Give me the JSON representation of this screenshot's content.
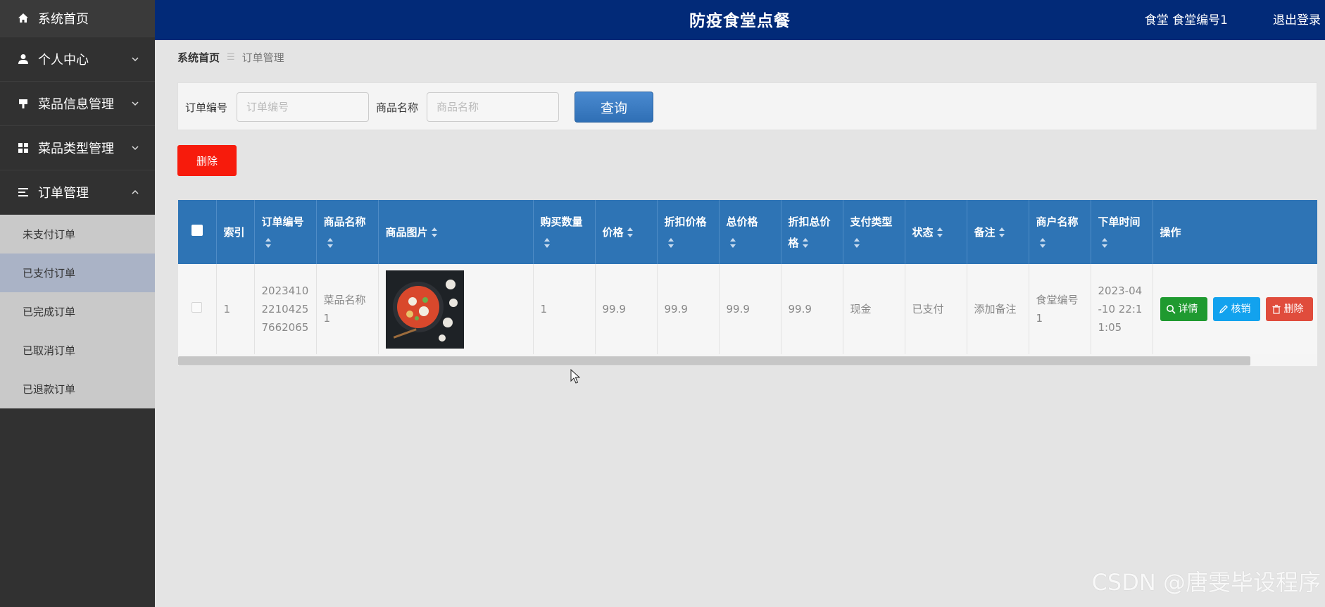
{
  "app": {
    "title": "防疫食堂点餐",
    "user_label": "食堂 食堂编号1",
    "logout_label": "退出登录"
  },
  "sidebar": {
    "items": [
      {
        "label": "系统首页",
        "icon": "home-icon"
      },
      {
        "label": "个人中心",
        "icon": "user-icon"
      },
      {
        "label": "菜品信息管理",
        "icon": "dish-icon"
      },
      {
        "label": "菜品类型管理",
        "icon": "grid-icon"
      },
      {
        "label": "订单管理",
        "icon": "list-icon"
      }
    ],
    "submenu": [
      {
        "label": "未支付订单"
      },
      {
        "label": "已支付订单",
        "active": true
      },
      {
        "label": "已完成订单"
      },
      {
        "label": "已取消订单"
      },
      {
        "label": "已退款订单"
      }
    ]
  },
  "breadcrumb": {
    "home": "系统首页",
    "separator": "☰",
    "current": "订单管理"
  },
  "search": {
    "order_no_label": "订单编号",
    "order_no_placeholder": "订单编号",
    "goods_name_label": "商品名称",
    "goods_name_placeholder": "商品名称",
    "query_label": "查询"
  },
  "actions": {
    "delete_label": "删除"
  },
  "table": {
    "columns": [
      "索引",
      "订单编号",
      "商品名称",
      "商品图片",
      "购买数量",
      "价格",
      "折扣价格",
      "总价格",
      "折扣总价格",
      "支付类型",
      "状态",
      "备注",
      "商户名称",
      "下单时间",
      "操作"
    ],
    "rows": [
      {
        "index": "1",
        "order_no": "20234102210425 7662065",
        "order_no_display": "2023410\n2210425\n7662065",
        "goods_name": "菜品名称1",
        "quantity": "1",
        "price": "99.9",
        "discount_price": "99.9",
        "total_price": "99.9",
        "discount_total": "99.9",
        "pay_type": "现金",
        "status": "已支付",
        "remark": "添加备注",
        "merchant": "食堂编号1",
        "order_time": "2023-04-10 22:11:05"
      }
    ],
    "row_actions": {
      "detail": "详情",
      "verify": "核销",
      "remove": "删除"
    }
  },
  "watermark": "CSDN @唐雯毕设程序",
  "colors": {
    "header_bg": "#022a78",
    "sidebar_bg": "#313131",
    "table_header_bg": "#2e74b5",
    "delete_red": "#f71b0c",
    "detail_green": "#1f9a30",
    "verify_blue": "#12a2ee",
    "remove_red": "#e04c3c"
  }
}
